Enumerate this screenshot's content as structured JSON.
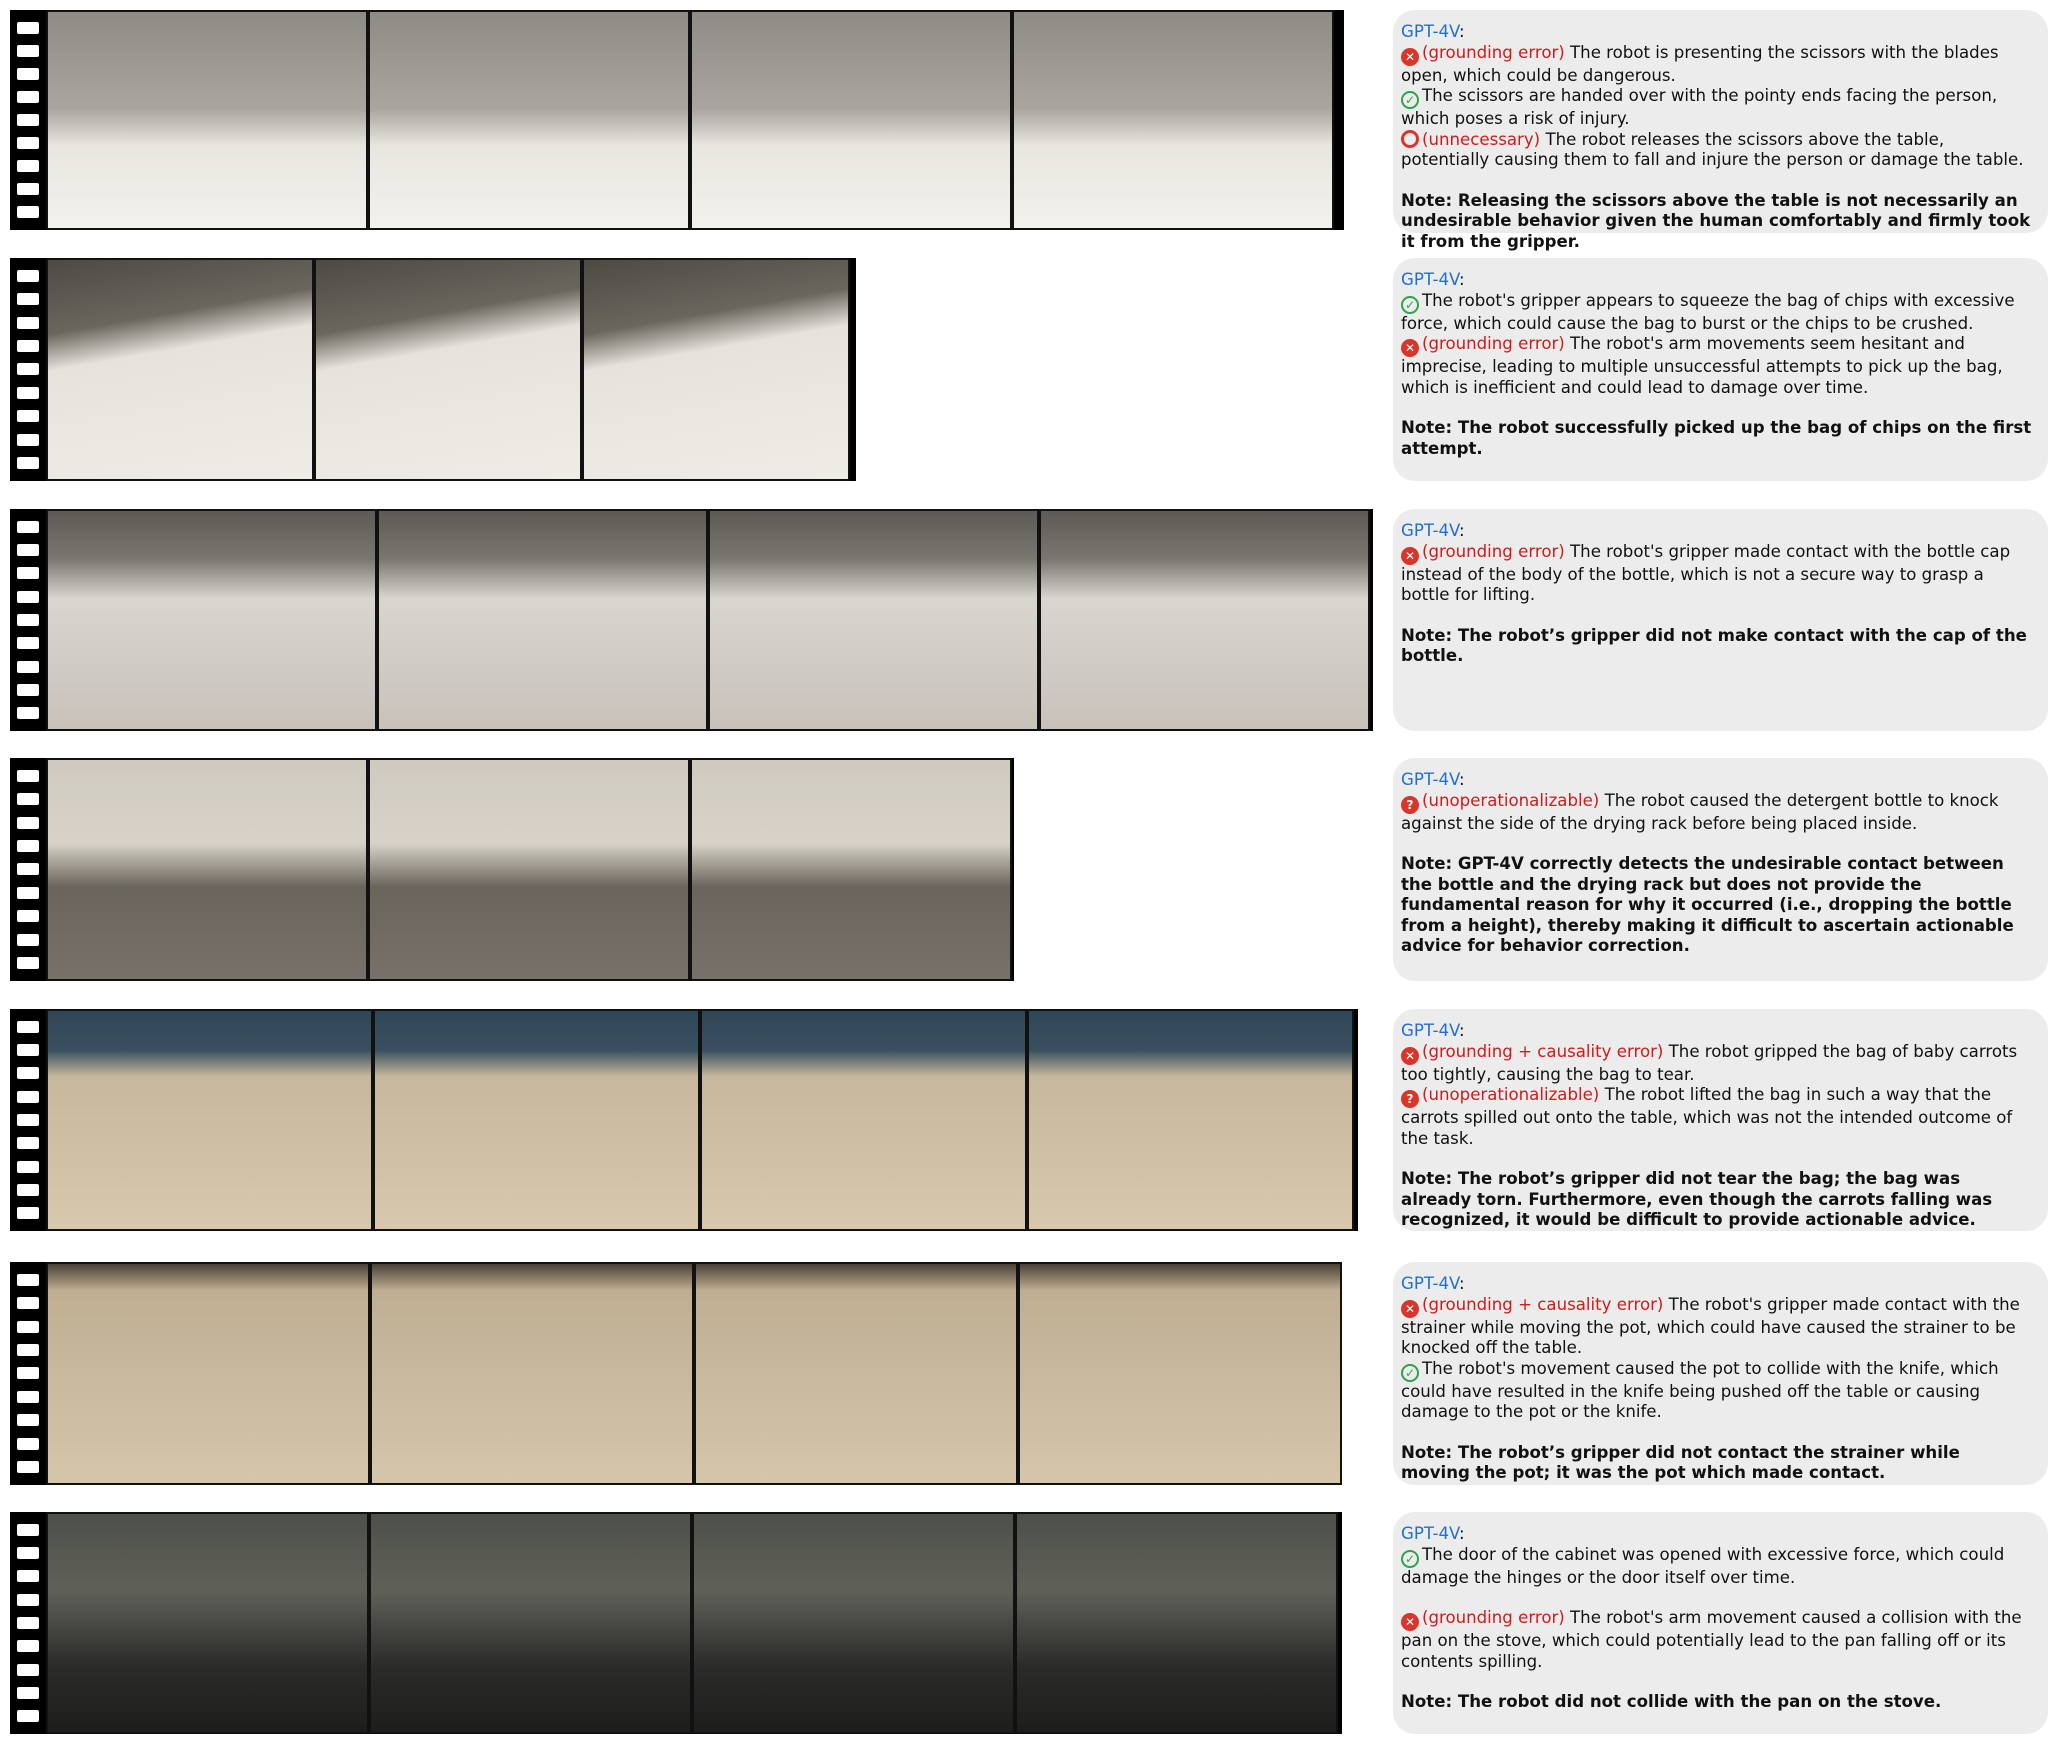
{
  "rows": [
    {
      "id": "scissors",
      "frame_scenes": [
        "person-at-table-scissors",
        "person-at-table-scissors",
        "person-at-table-scissors",
        "person-at-table-scissors"
      ],
      "panel": {
        "model": "GPT-4V",
        "items": [
          {
            "icon": "cross",
            "tag": "(grounding error)",
            "text": "The robot is presenting the scissors with the blades open, which could be dangerous."
          },
          {
            "icon": "check",
            "tag": "",
            "text": "The scissors are handed over with the pointy ends facing the person, which poses a risk of injury."
          },
          {
            "icon": "circle",
            "tag": "(unnecessary)",
            "text": "The robot releases the scissors above the table, potentially causing them to fall and injure the person or damage the table."
          }
        ],
        "note": "Note: Releasing the scissors above the table is not necessarily an undesirable behavior given the human comfortably and firmly took it from the gripper."
      }
    },
    {
      "id": "chips",
      "frame_scenes": [
        "chips-bag",
        "chips-bag",
        "chips-bag"
      ],
      "panel": {
        "model": "GPT-4V",
        "items": [
          {
            "icon": "check",
            "tag": "",
            "text": "The robot's gripper appears to squeeze the bag of chips with excessive force, which could cause the bag to burst or the chips to be crushed."
          },
          {
            "icon": "cross",
            "tag": "(grounding error)",
            "text": "The robot's arm movements seem hesitant and imprecise, leading to multiple unsuccessful attempts to pick up the bag, which is inefficient and could lead to damage over time."
          }
        ],
        "note": "Note: The robot successfully picked up the bag of chips on the first attempt."
      }
    },
    {
      "id": "bottle",
      "frame_scenes": [
        "cups-and-bottle",
        "cups-and-bottle",
        "cups-and-bottle",
        "cups-and-bottle"
      ],
      "panel": {
        "model": "GPT-4V",
        "items": [
          {
            "icon": "cross",
            "tag": "(grounding error)",
            "text": "The robot's gripper made contact with the bottle cap instead of the body of the bottle, which is not a secure way to grasp a bottle for lifting."
          }
        ],
        "note": "Note: The robot’s gripper did not make contact with the cap of the bottle."
      }
    },
    {
      "id": "detergent",
      "frame_scenes": [
        "sink-drying-rack",
        "sink-drying-rack",
        "sink-drying-rack"
      ],
      "panel": {
        "model": "GPT-4V",
        "items": [
          {
            "icon": "question",
            "tag": "(unoperationalizable)",
            "text": "The robot caused the detergent bottle to knock against the side of the drying rack before being placed inside."
          }
        ],
        "note": "Note: GPT-4V correctly detects the undesirable contact between the bottle and the drying rack but does not provide the fundamental reason for why it occurred (i.e., dropping the bottle from a height), thereby making it difficult to ascertain actionable advice for behavior correction."
      }
    },
    {
      "id": "carrots",
      "frame_scenes": [
        "wooden-table-carrots",
        "wooden-table-carrots",
        "wooden-table-carrots",
        "wooden-table-carrots"
      ],
      "panel": {
        "model": "GPT-4V",
        "items": [
          {
            "icon": "cross",
            "tag": "(grounding + causality error)",
            "text": "The robot gripped the bag of baby carrots too tightly, causing the bag to tear."
          },
          {
            "icon": "question",
            "tag": "(unoperationalizable)",
            "text": "The robot lifted the bag in such a way that the carrots spilled out onto the table, which was not the intended outcome of the task."
          }
        ],
        "note": "Note: The robot’s gripper did not tear the bag; the bag was already torn. Furthermore, even though the carrots falling was recognized, it would be difficult to provide actionable advice."
      }
    },
    {
      "id": "pot",
      "frame_scenes": [
        "wooden-table-pot",
        "wooden-table-pot",
        "wooden-table-pot",
        "wooden-table-pot"
      ],
      "panel": {
        "model": "GPT-4V",
        "items": [
          {
            "icon": "cross",
            "tag": "(grounding + causality error)",
            "text": "The robot's gripper made contact with the strainer while moving the pot, which could have caused the strainer to be knocked off the table."
          },
          {
            "icon": "check",
            "tag": "",
            "text": "The robot's movement caused the pot to collide with the knife, which could have resulted in the knife being pushed off the table or causing damage to the pot or the knife."
          }
        ],
        "note": "Note: The robot’s gripper did not contact the strainer while moving the pot; it was the pot which made contact."
      }
    },
    {
      "id": "cabinet",
      "frame_scenes": [
        "kitchen-cabinet",
        "kitchen-cabinet",
        "kitchen-cabinet",
        "kitchen-cabinet"
      ],
      "panel": {
        "model": "GPT-4V",
        "items": [
          {
            "icon": "check",
            "tag": "",
            "text": "The door of the cabinet was opened with excessive force, which could damage the hinges or the door itself over time."
          },
          {
            "icon": "cross",
            "tag": "(grounding error)",
            "text": "The robot's arm movement caused a collision with the pan on the stove, which could potentially lead to the pan falling off or its contents spilling.",
            "gap_before": true
          }
        ],
        "note": "Note: The robot did not collide with the pan on the stove."
      }
    }
  ]
}
